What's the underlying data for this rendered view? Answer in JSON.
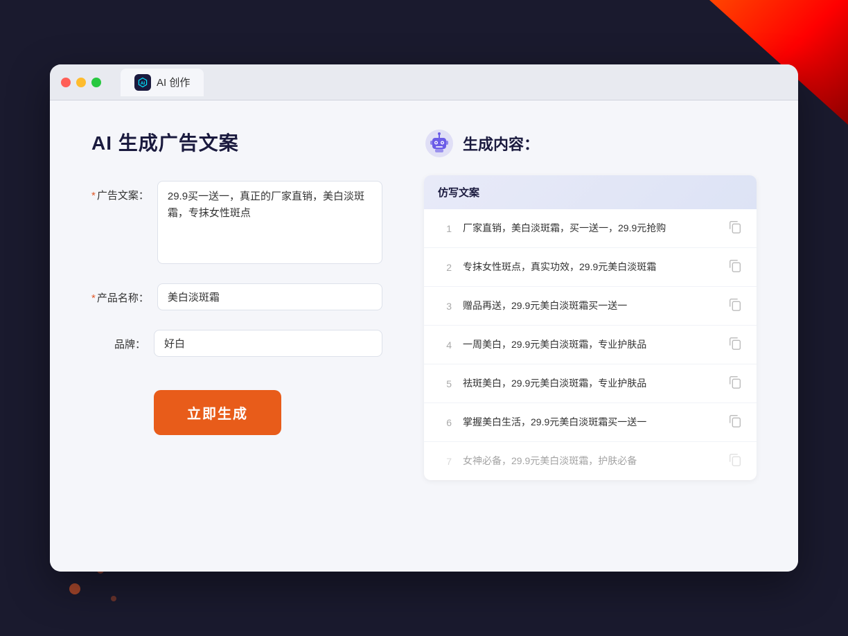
{
  "browser": {
    "tab_label": "AI 创作"
  },
  "page": {
    "title": "AI 生成广告文案",
    "right_title": "生成内容："
  },
  "form": {
    "ad_copy_label": "广告文案：",
    "ad_copy_required": "*",
    "ad_copy_value": "29.9买一送一，真正的厂家直销，美白淡斑霜，专抹女性斑点",
    "product_name_label": "产品名称：",
    "product_name_required": "*",
    "product_name_value": "美白淡斑霜",
    "brand_label": "品牌：",
    "brand_value": "好白",
    "generate_button": "立即生成"
  },
  "results": {
    "section_header": "仿写文案",
    "items": [
      {
        "num": "1",
        "text": "厂家直销，美白淡斑霜，买一送一，29.9元抢购",
        "faded": false
      },
      {
        "num": "2",
        "text": "专抹女性斑点，真实功效，29.9元美白淡斑霜",
        "faded": false
      },
      {
        "num": "3",
        "text": "赠品再送，29.9元美白淡斑霜买一送一",
        "faded": false
      },
      {
        "num": "4",
        "text": "一周美白，29.9元美白淡斑霜，专业护肤品",
        "faded": false
      },
      {
        "num": "5",
        "text": "祛斑美白，29.9元美白淡斑霜，专业护肤品",
        "faded": false
      },
      {
        "num": "6",
        "text": "掌握美白生活，29.9元美白淡斑霜买一送一",
        "faded": false
      },
      {
        "num": "7",
        "text": "女神必备，29.9元美白淡斑霜，护肤必备",
        "faded": true
      }
    ]
  }
}
